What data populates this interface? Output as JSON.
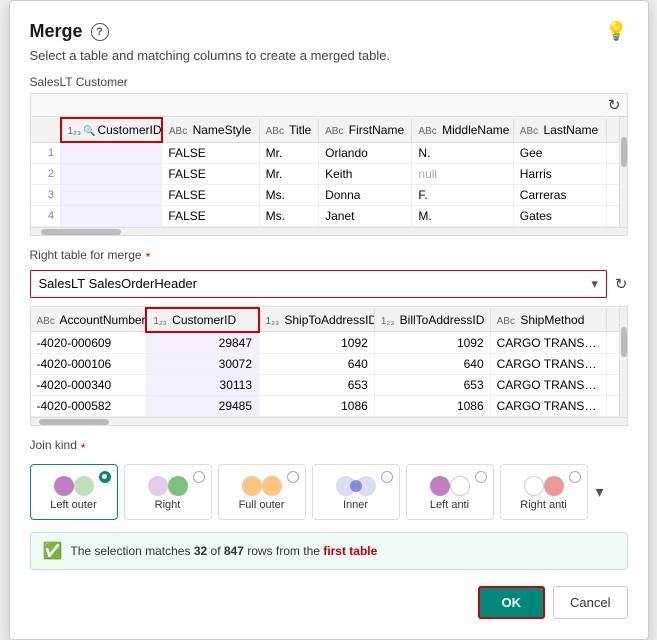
{
  "dialog": {
    "title": "Merge",
    "subtitle": "Select a table and matching columns to create a merged table.",
    "ok_label": "OK",
    "cancel_label": "Cancel"
  },
  "top_table": {
    "label": "SalesLT Customer",
    "columns": [
      {
        "name": "CustomerID",
        "type": "1₂₃",
        "icon": "🔍",
        "selected": true
      },
      {
        "name": "NameStyle",
        "type": "ABc",
        "selected": false
      },
      {
        "name": "Title",
        "type": "ABc",
        "selected": false
      },
      {
        "name": "FirstName",
        "type": "ABc",
        "selected": false
      },
      {
        "name": "MiddleName",
        "type": "ABc",
        "selected": false
      },
      {
        "name": "LastName",
        "type": "ABc",
        "selected": false
      }
    ],
    "rows": [
      {
        "num": "1",
        "col1": "FALSE",
        "col2": "Mr.",
        "col3": "Orlando",
        "col4": "N.",
        "col5": "Gee"
      },
      {
        "num": "2",
        "col1": "FALSE",
        "col2": "Mr.",
        "col3": "Keith",
        "col4": "null",
        "col5": "Harris"
      },
      {
        "num": "3",
        "col1": "FALSE",
        "col2": "Ms.",
        "col3": "Donna",
        "col4": "F.",
        "col5": "Carreras"
      },
      {
        "num": "4",
        "col1": "FALSE",
        "col2": "Ms.",
        "col3": "Janet",
        "col4": "M.",
        "col5": "Gates"
      }
    ]
  },
  "right_table": {
    "section_label": "Right table for merge",
    "required": true,
    "selected_value": "SalesLT SalesOrderHeader",
    "columns": [
      {
        "name": "AccountNumber",
        "type": "ABc",
        "selected": false
      },
      {
        "name": "CustomerID",
        "type": "1₂₃",
        "selected": true
      },
      {
        "name": "ShipToAddressID",
        "type": "1₂₃",
        "selected": false
      },
      {
        "name": "BillToAddressID",
        "type": "1₂₃",
        "selected": false
      },
      {
        "name": "ShipMethod",
        "type": "ABc",
        "selected": false
      }
    ],
    "rows": [
      {
        "col0": "-4020-000609",
        "col1": "29847",
        "col2": "1092",
        "col3": "1092",
        "col4": "CARGO TRANSPO..."
      },
      {
        "col0": "-4020-000106",
        "col1": "30072",
        "col2": "640",
        "col3": "640",
        "col4": "CARGO TRANSPO..."
      },
      {
        "col0": "-4020-000340",
        "col1": "30113",
        "col2": "653",
        "col3": "653",
        "col4": "CARGO TRANSPO..."
      },
      {
        "col0": "-4020-000582",
        "col1": "29485",
        "col2": "1086",
        "col3": "1086",
        "col4": "CARGO TRANSPO..."
      }
    ]
  },
  "join_kind": {
    "label": "Join kind",
    "required": true,
    "options": [
      {
        "id": "left-outer",
        "label": "Left outer",
        "selected": true,
        "venn": "lo"
      },
      {
        "id": "right",
        "label": "Right",
        "selected": false,
        "venn": "ri"
      },
      {
        "id": "full-outer",
        "label": "Full outer",
        "selected": false,
        "venn": "fo"
      },
      {
        "id": "inner",
        "label": "Inner",
        "selected": false,
        "venn": "in"
      },
      {
        "id": "left-anti",
        "label": "Left anti",
        "selected": false,
        "venn": "la"
      },
      {
        "id": "right-anti",
        "label": "Right anti",
        "selected": false,
        "venn": "ra"
      }
    ]
  },
  "info": {
    "text_prefix": "The selection matches ",
    "count": "32",
    "text_mid": " of ",
    "total": "847",
    "text_suffix": " rows from the ",
    "highlight": "first table"
  }
}
